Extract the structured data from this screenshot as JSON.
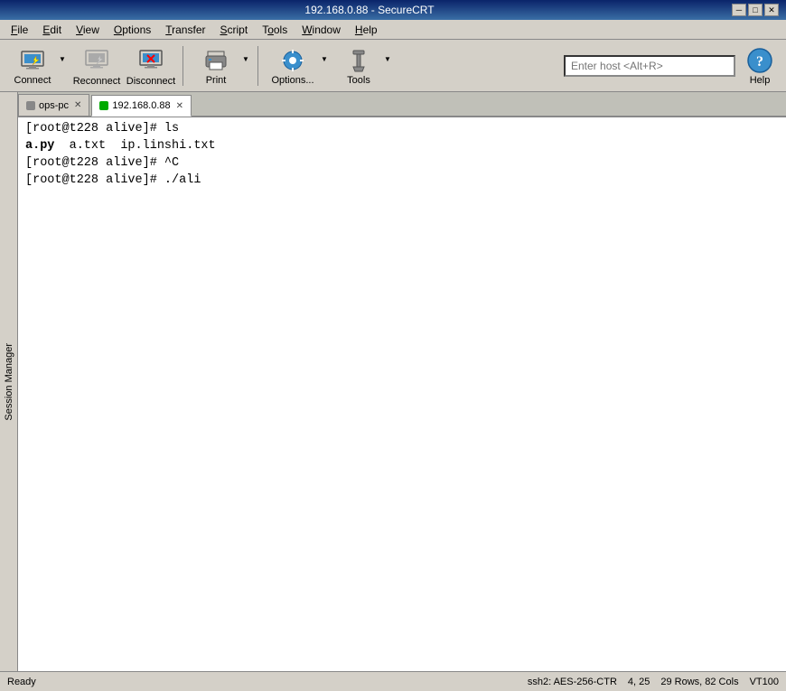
{
  "window": {
    "title": "192.168.0.88 - SecureCRT"
  },
  "titlebar": {
    "minimize": "─",
    "maximize": "□",
    "close": "✕"
  },
  "menubar": {
    "items": [
      {
        "label": "File",
        "underline_index": 0
      },
      {
        "label": "Edit",
        "underline_index": 0
      },
      {
        "label": "View",
        "underline_index": 0
      },
      {
        "label": "Options",
        "underline_index": 0
      },
      {
        "label": "Transfer",
        "underline_index": 0
      },
      {
        "label": "Script",
        "underline_index": 0
      },
      {
        "label": "Tools",
        "underline_index": 0
      },
      {
        "label": "Window",
        "underline_index": 0
      },
      {
        "label": "Help",
        "underline_index": 0
      }
    ]
  },
  "toolbar": {
    "connect_label": "Connect",
    "reconnect_label": "Reconnect",
    "disconnect_label": "Disconnect",
    "print_label": "Print",
    "options_label": "Options...",
    "tools_label": "Tools",
    "help_label": "Help",
    "host_input_placeholder": "Enter host <Alt+R>"
  },
  "session_manager": {
    "label": "Session Manager"
  },
  "tabs": [
    {
      "id": "ops-pc",
      "label": "ops-pc",
      "active": false,
      "indicator": "inactive"
    },
    {
      "id": "192.168.0.88",
      "label": "192.168.0.88",
      "active": true,
      "indicator": "active-green"
    }
  ],
  "terminal": {
    "lines": [
      {
        "text": "[root@t228 alive]# ls",
        "bold": false
      },
      {
        "text": "a.py  a.txt  ip.linshi.txt",
        "bold": true,
        "bold_part": "a.py"
      },
      {
        "text": "[root@t228 alive]# ^C",
        "bold": false
      },
      {
        "text": "[root@t228 alive]# ./ali",
        "bold": false
      }
    ]
  },
  "statusbar": {
    "left": "Ready",
    "encryption": "ssh2: AES-256-CTR",
    "position": "4, 25",
    "dimensions": "29 Rows, 82 Cols",
    "terminal_type": "VT100"
  }
}
